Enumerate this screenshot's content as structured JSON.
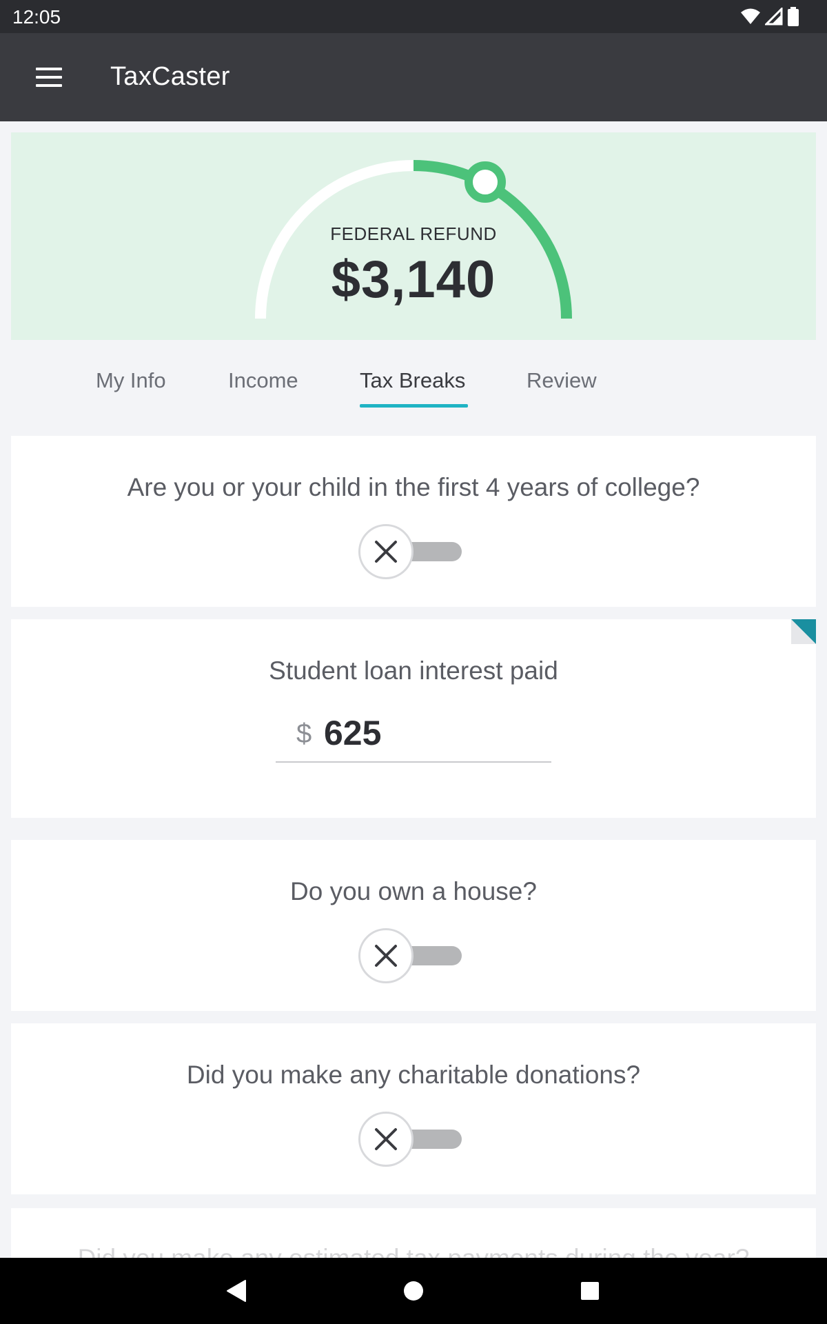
{
  "status_bar": {
    "time": "12:05",
    "icons": [
      "wifi-icon",
      "signal-icon",
      "battery-icon"
    ]
  },
  "app_bar": {
    "menu_icon": "hamburger-menu-icon",
    "title": "TaxCaster"
  },
  "refund": {
    "label": "FEDERAL REFUND",
    "amount": "$3,140",
    "gauge_colors": {
      "filled": "#4cc27a",
      "track": "#ffffff",
      "background": "#e1f3e8"
    }
  },
  "tabs": [
    {
      "label": "My Info",
      "active": false
    },
    {
      "label": "Income",
      "active": false
    },
    {
      "label": "Tax Breaks",
      "active": true
    },
    {
      "label": "Review",
      "active": false
    }
  ],
  "cards": {
    "college": {
      "question": "Are you or your child in the first 4 years of college?",
      "toggle_on": false
    },
    "student_loan": {
      "label": "Student loan interest paid",
      "currency": "$",
      "value": "625"
    },
    "house": {
      "question": "Do you own a house?",
      "toggle_on": false
    },
    "charity": {
      "question": "Did you make any charitable donations?",
      "toggle_on": false
    },
    "estimated": {
      "question": "Did you make any estimated tax payments during the year?"
    }
  },
  "colors": {
    "accent": "#1fb3c4",
    "corner_tag": "#1a8fa0",
    "app_bar": "#3a3b40"
  },
  "nav_bar": {
    "icons": [
      "back-icon",
      "home-icon",
      "recents-icon"
    ]
  }
}
